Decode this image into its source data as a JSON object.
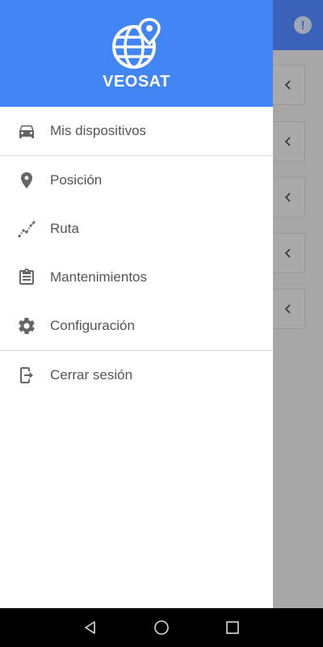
{
  "app": {
    "brand": "VEOSAT"
  },
  "menu": {
    "items": [
      {
        "label": "Mis dispositivos",
        "icon": "car-icon"
      },
      {
        "label": "Posición",
        "icon": "map-pin-icon"
      },
      {
        "label": "Ruta",
        "icon": "route-icon"
      },
      {
        "label": "Mantenimientos",
        "icon": "clipboard-icon"
      },
      {
        "label": "Configuración",
        "icon": "gear-icon"
      },
      {
        "label": "Cerrar sesión",
        "icon": "logout-icon"
      }
    ]
  },
  "colors": {
    "header": "#4285f4",
    "bg_header": "#3a62b8",
    "text": "#555555",
    "icon": "#666666"
  }
}
